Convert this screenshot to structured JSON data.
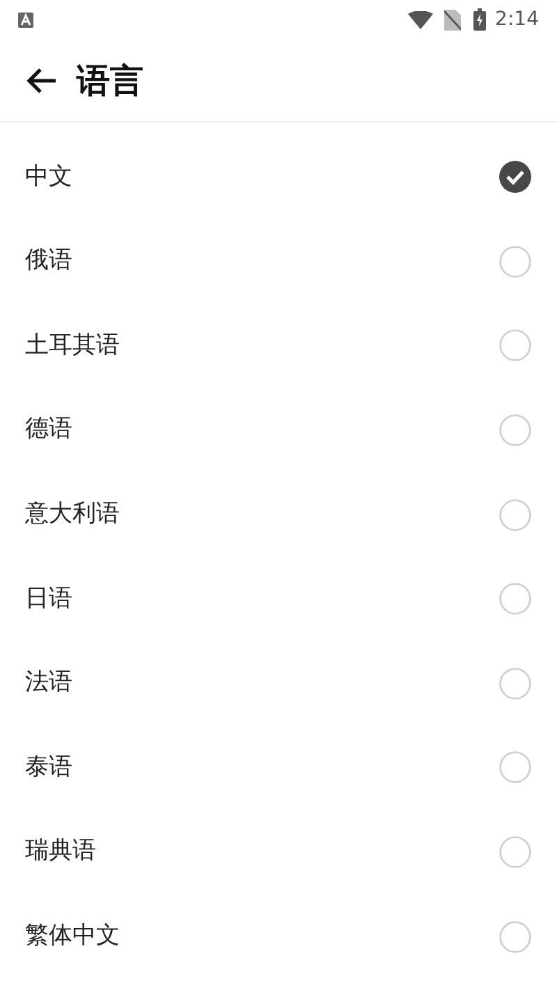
{
  "status_bar": {
    "time": "2:14"
  },
  "header": {
    "title": "语言"
  },
  "languages": [
    {
      "label": "中文",
      "selected": true
    },
    {
      "label": "俄语",
      "selected": false
    },
    {
      "label": "土耳其语",
      "selected": false
    },
    {
      "label": "德语",
      "selected": false
    },
    {
      "label": "意大利语",
      "selected": false
    },
    {
      "label": "日语",
      "selected": false
    },
    {
      "label": "法语",
      "selected": false
    },
    {
      "label": "泰语",
      "selected": false
    },
    {
      "label": "瑞典语",
      "selected": false
    },
    {
      "label": "繁体中文",
      "selected": false
    }
  ]
}
